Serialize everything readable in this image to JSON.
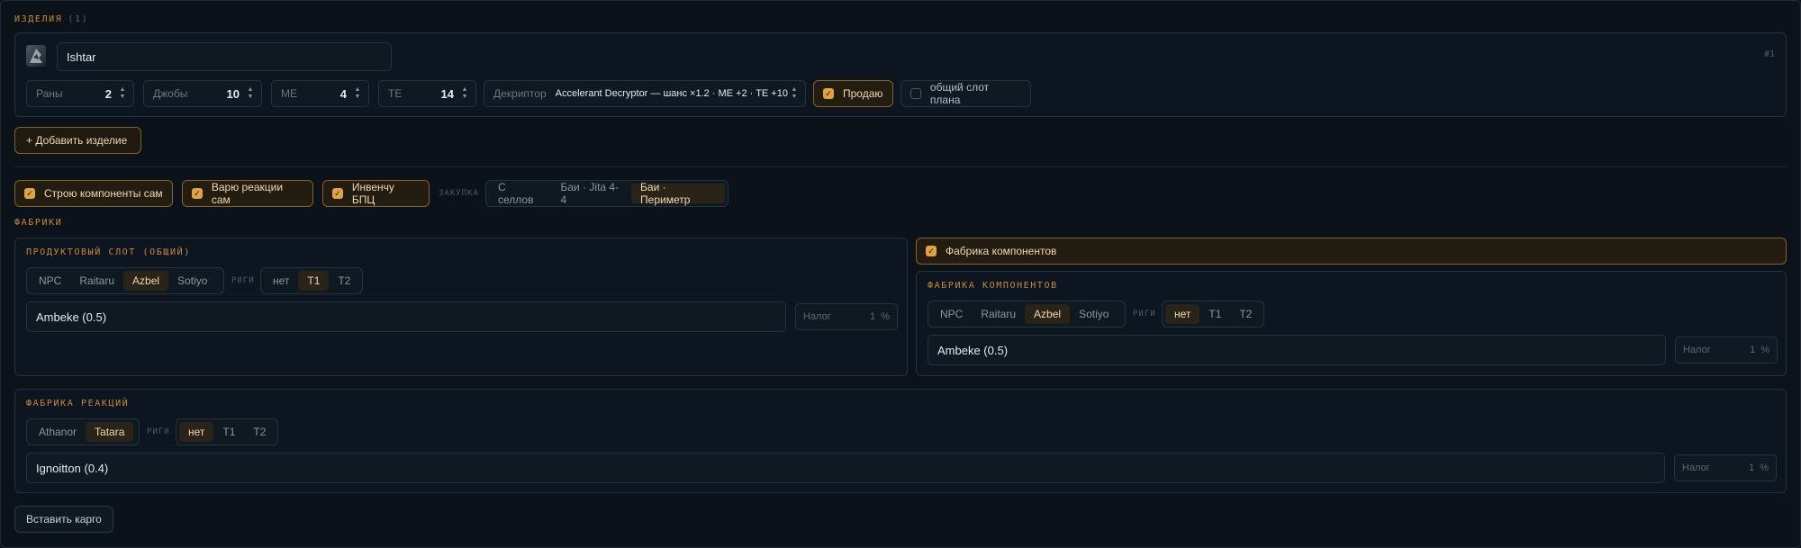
{
  "products": {
    "title": "ИЗДЕЛИЯ",
    "count": "(1)",
    "item": {
      "name": "Ishtar",
      "index": "#1",
      "runs_label": "Раны",
      "runs_value": "2",
      "jobs_label": "Джобы",
      "jobs_value": "10",
      "me_label": "ME",
      "me_value": "4",
      "te_label": "TE",
      "te_value": "14",
      "decryptor_label": "Декриптор",
      "decryptor_value": "Accelerant Decryptor — шанс ×1.2 · ME +2 · TE +10",
      "sell_label": "Продаю",
      "shared_slot_label": "общий слот плана"
    },
    "add_button": "+ Добавить изделие"
  },
  "options": {
    "build_components": "Строю компоненты сам",
    "cook_reactions": "Варю реакции сам",
    "invent_bpc": "Инвенчу БПЦ",
    "purchase_label": "ЗАКУПКА",
    "purchase_options": [
      "С селлов",
      "Баи · Jita 4-4",
      "Баи · Периметр"
    ],
    "purchase_active": "Баи · Периметр"
  },
  "factories": {
    "title": "ФАБРИКИ",
    "product_slot": {
      "title": "ПРОДУКТОВЫЙ СЛОТ (ОБЩИЙ)",
      "structures": [
        "NPC",
        "Raitaru",
        "Azbel",
        "Sotiyo"
      ],
      "structure_active": "Azbel",
      "rigs_label": "РИГИ",
      "rigs": [
        "нет",
        "T1",
        "T2"
      ],
      "rig_active": "T1",
      "system": "Ambeke (0.5)",
      "tax_label": "Налог",
      "tax_value": "1",
      "tax_unit": "%"
    },
    "component_toggle": "Фабрика компонентов",
    "component_factory": {
      "title": "ФАБРИКА КОМПОНЕНТОВ",
      "structures": [
        "NPC",
        "Raitaru",
        "Azbel",
        "Sotiyo"
      ],
      "structure_active": "Azbel",
      "rigs_label": "РИГИ",
      "rigs": [
        "нет",
        "T1",
        "T2"
      ],
      "rig_active": "нет",
      "system": "Ambeke (0.5)",
      "tax_label": "Налог",
      "tax_value": "1",
      "tax_unit": "%"
    },
    "reaction_factory": {
      "title": "ФАБРИКА РЕАКЦИЙ",
      "structures": [
        "Athanor",
        "Tatara"
      ],
      "structure_active": "Tatara",
      "rigs_label": "РИГИ",
      "rigs": [
        "нет",
        "T1",
        "T2"
      ],
      "rig_active": "нет",
      "system": "Ignoitton (0.4)",
      "tax_label": "Налог",
      "tax_value": "1",
      "tax_unit": "%"
    }
  },
  "paste_cargo": "Вставить карго",
  "colors": {
    "accent": "#e0a33f",
    "background": "#0b121a",
    "panel_border": "#233140"
  },
  "icons": {
    "ship": "ship-thumbnail-icon",
    "checkbox": "checkmark-icon",
    "spinner": "up-down-arrows-icon"
  }
}
